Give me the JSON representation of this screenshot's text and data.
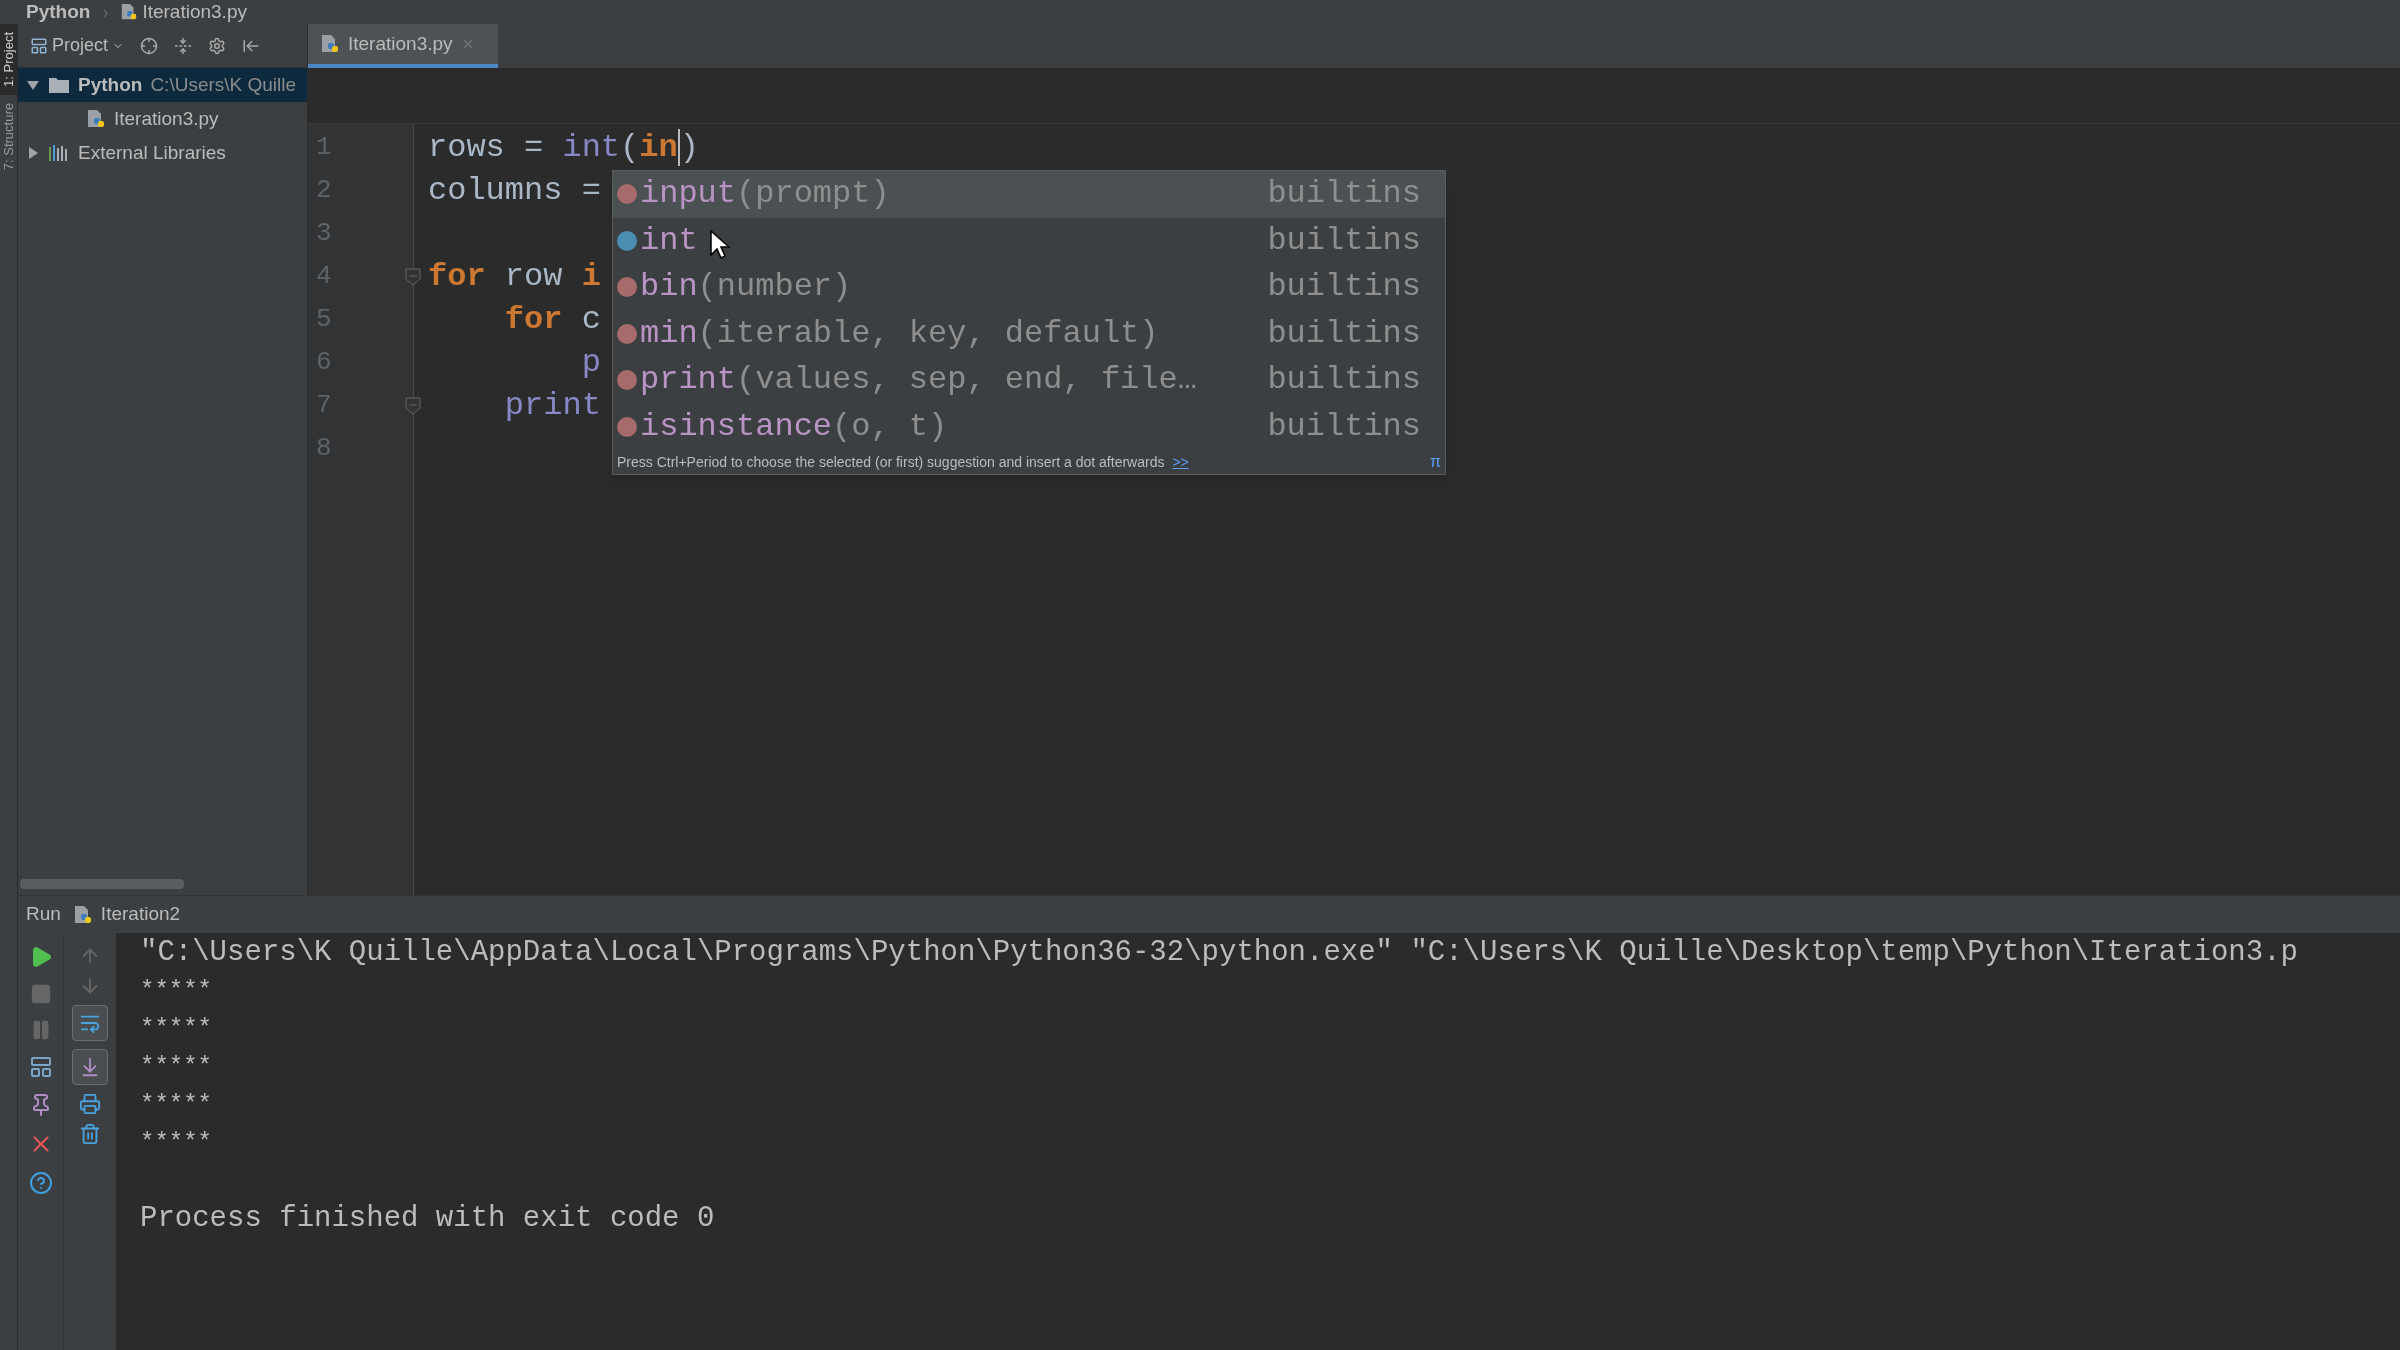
{
  "breadcrumb_separator": "›",
  "breadcrumb": [
    {
      "label": "Python",
      "kind": "folder"
    },
    {
      "label": "Iteration3.py",
      "kind": "python_file"
    }
  ],
  "side_stripe": [
    {
      "label": "1: Project",
      "selected": true
    },
    {
      "label": "7: Structure",
      "selected": false
    }
  ],
  "project_panel": {
    "title": "Project",
    "tree": [
      {
        "label": "Python",
        "path": "C:\\Users\\K Quille",
        "kind": "folder",
        "expanded": true,
        "selected": true,
        "children": [
          {
            "label": "Iteration3.py",
            "kind": "python_file",
            "selected": false
          }
        ]
      },
      {
        "label": "External Libraries",
        "kind": "library",
        "expanded": false,
        "selected": false
      }
    ]
  },
  "editor_tabs": [
    {
      "label": "Iteration3.py",
      "selected": true
    }
  ],
  "code_lines": [
    {
      "number": "1",
      "tokens": [
        {
          "text": "rows = ",
          "kind": "plain"
        },
        {
          "text": "int",
          "kind": "builtin"
        },
        {
          "text": "(",
          "kind": "plain"
        },
        {
          "text": "in",
          "kind": "keyword",
          "caret": true
        },
        {
          "text": ")",
          "kind": "plain"
        }
      ]
    },
    {
      "number": "2",
      "tokens": [
        {
          "text": "columns =",
          "kind": "plain"
        }
      ]
    },
    {
      "number": "3"
    },
    {
      "number": "4",
      "fold": true,
      "tokens": [
        {
          "text": "for",
          "kind": "keyword"
        },
        {
          "text": " row ",
          "kind": "plain"
        },
        {
          "text": "i",
          "kind": "keyword"
        }
      ]
    },
    {
      "number": "5",
      "tokens": [
        {
          "text": "    for",
          "kind": "keyword"
        },
        {
          "text": " c",
          "kind": "plain"
        }
      ]
    },
    {
      "number": "6",
      "tokens": [
        {
          "text": "        p",
          "kind": "builtin"
        }
      ]
    },
    {
      "number": "7",
      "fold": true,
      "tokens": [
        {
          "text": "    print",
          "kind": "builtin"
        }
      ]
    },
    {
      "number": "8"
    }
  ],
  "completion_popup": {
    "items": [
      {
        "kind": "function",
        "name": "input",
        "params": "(prompt)",
        "source": "builtins",
        "selected": true
      },
      {
        "kind": "class",
        "name": "int",
        "source": "builtins",
        "selected": false
      },
      {
        "kind": "function",
        "name": "bin",
        "params": "(number)",
        "source": "builtins",
        "selected": false
      },
      {
        "kind": "function",
        "name": "min",
        "params": "(iterable, key, default)",
        "source": "builtins",
        "selected": false
      },
      {
        "kind": "function",
        "name": "print",
        "params": "(values, sep, end, file…",
        "source": "builtins",
        "selected": false
      },
      {
        "kind": "function",
        "name": "isinstance",
        "params": "(o, t)",
        "source": "builtins",
        "selected": false
      }
    ],
    "hint": "Press Ctrl+Period to choose the selected (or first) suggestion and insert a dot afterwards",
    "hint_link": ">>",
    "corner_mark": "π"
  },
  "run_panel": {
    "title": "Run",
    "config": "Iteration2",
    "toggles": [
      {
        "on": true
      },
      {
        "on": true
      }
    ],
    "console": [
      {
        "kind": "command",
        "text": "\"C:\\Users\\K Quille\\AppData\\Local\\Programs\\Python\\Python36-32\\python.exe\" \"C:\\Users\\K Quille\\Desktop\\temp\\Python\\Iteration3.p"
      },
      {
        "kind": "output",
        "text": "*****"
      },
      {
        "kind": "output",
        "text": "*****"
      },
      {
        "kind": "output",
        "text": "*****"
      },
      {
        "kind": "output",
        "text": "*****"
      },
      {
        "kind": "output",
        "text": "*****"
      },
      {
        "kind": "status",
        "text": "Process finished with exit code 0"
      }
    ]
  }
}
